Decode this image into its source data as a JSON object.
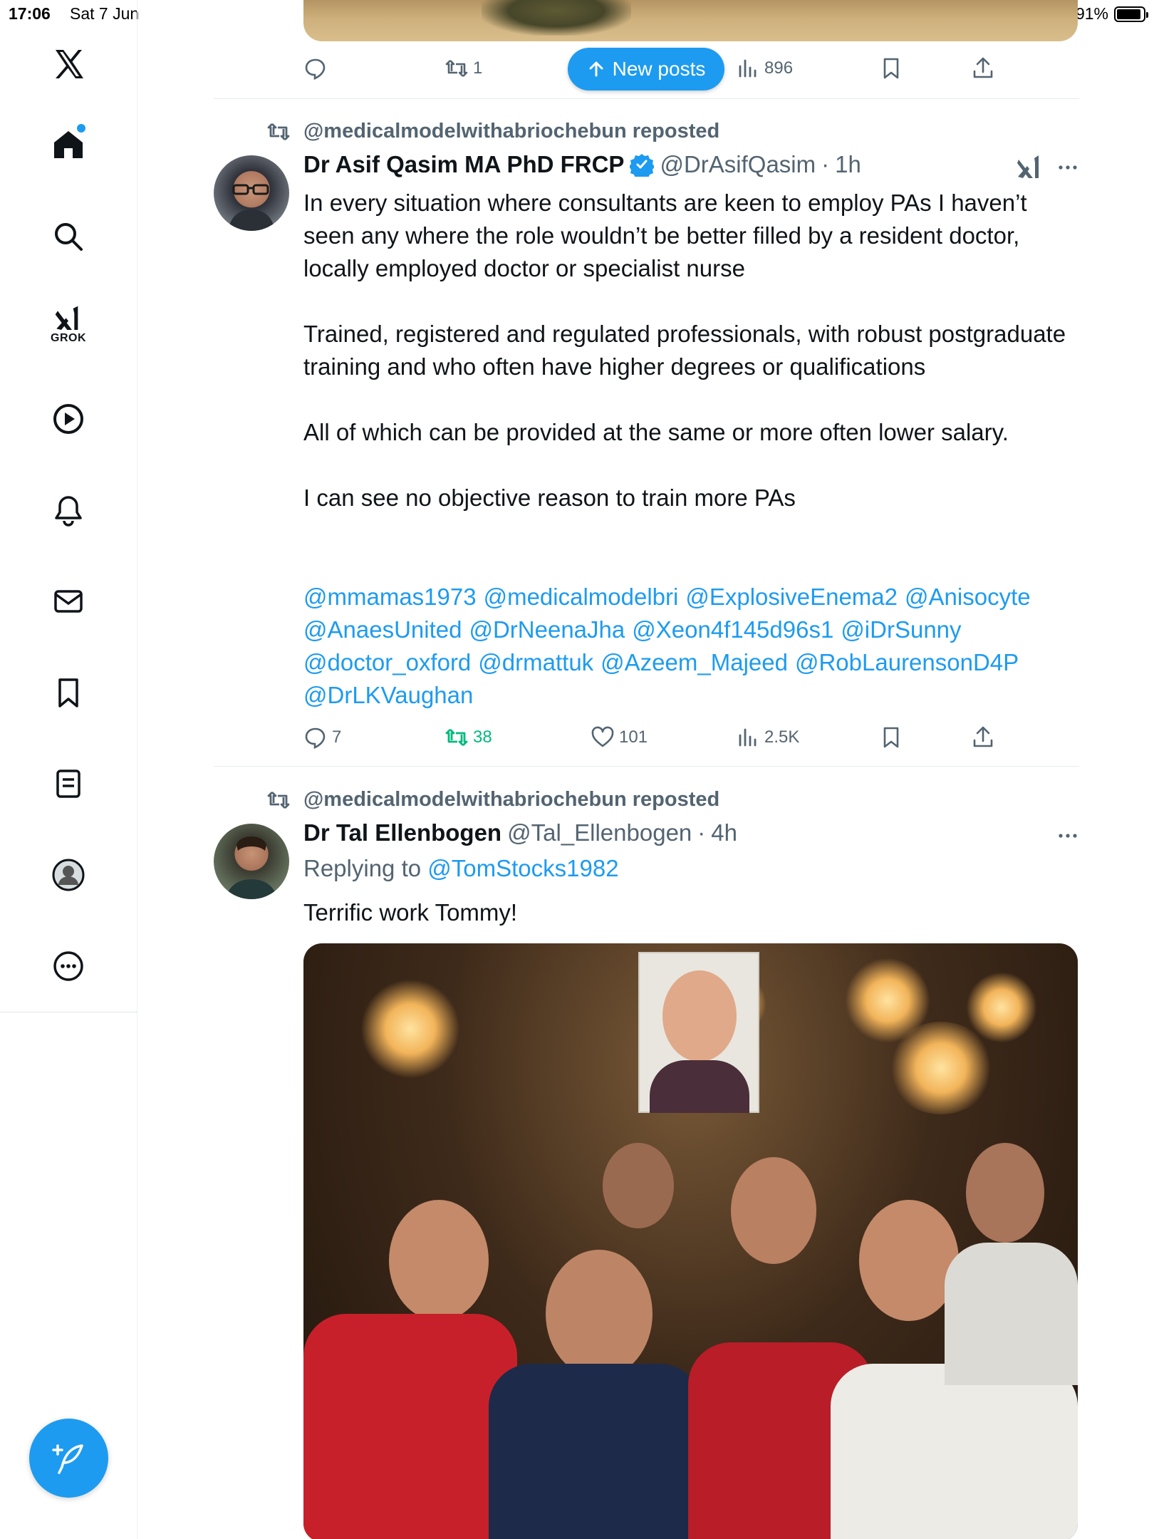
{
  "status_bar": {
    "time": "17:06",
    "date": "Sat 7 Jun",
    "battery": "91%",
    "battery_level": 0.91
  },
  "sidebar": {
    "items": [
      {
        "name": "x-logo"
      },
      {
        "name": "home"
      },
      {
        "name": "search"
      },
      {
        "name": "grok",
        "label": "GROK"
      },
      {
        "name": "video"
      },
      {
        "name": "notifications"
      },
      {
        "name": "messages"
      },
      {
        "name": "bookmarks"
      },
      {
        "name": "lists"
      },
      {
        "name": "profile"
      },
      {
        "name": "more"
      }
    ],
    "compose_label": "Post"
  },
  "top_post": {
    "retweets": "1",
    "views": "896"
  },
  "new_posts": {
    "label": "New posts"
  },
  "posts": [
    {
      "repost_by": "@medicalmodelwithabriochebun reposted",
      "name": "Dr Asif Qasim MA PhD FRCP",
      "verified": true,
      "handle": "@DrAsifQasim",
      "time": "1h",
      "paragraphs": [
        "In every situation where consultants are keen to employ PAs I haven’t seen any where the role wouldn’t be better filled by a resident doctor, locally employed doctor or specialist nurse",
        "Trained, registered and regulated professionals, with robust postgraduate training and who often have higher degrees or qualifications",
        "All of which can be provided at the same or more often lower salary.",
        "I can see no objective reason to train more PAs"
      ],
      "mentions": [
        "@mmamas1973",
        "@medicalmodelbri",
        "@ExplosiveEnema2",
        "@Anisocyte",
        "@AnaesUnited",
        "@DrNeenaJha",
        "@Xeon4f145d96s1",
        "@iDrSunny",
        "@doctor_oxford",
        "@drmattuk",
        "@Azeem_Majeed",
        "@RobLaurensonD4P",
        "@DrLKVaughan"
      ],
      "stats": {
        "replies": "7",
        "reposts": "38",
        "likes": "101",
        "views": "2.5K"
      }
    },
    {
      "repost_by": "@medicalmodelwithabriochebun reposted",
      "name": "Dr Tal Ellenbogen",
      "handle": "@Tal_Ellenbogen",
      "time": "4h",
      "replying_prefix": "Replying to ",
      "replying_to": "@TomStocks1982",
      "text": "Terrific work Tommy!"
    }
  ],
  "colors": {
    "accent": "#1d9bf0",
    "repost_green": "#00ba7c",
    "muted": "#536471"
  }
}
